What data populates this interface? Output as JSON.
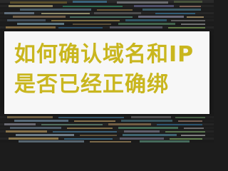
{
  "headline": {
    "text": "如何确认域名和IP是否已经正确绑"
  },
  "colors": {
    "title_text": "#c9b61e",
    "panel_background": "#ffffff",
    "background_dark": "#1c1c1c"
  }
}
